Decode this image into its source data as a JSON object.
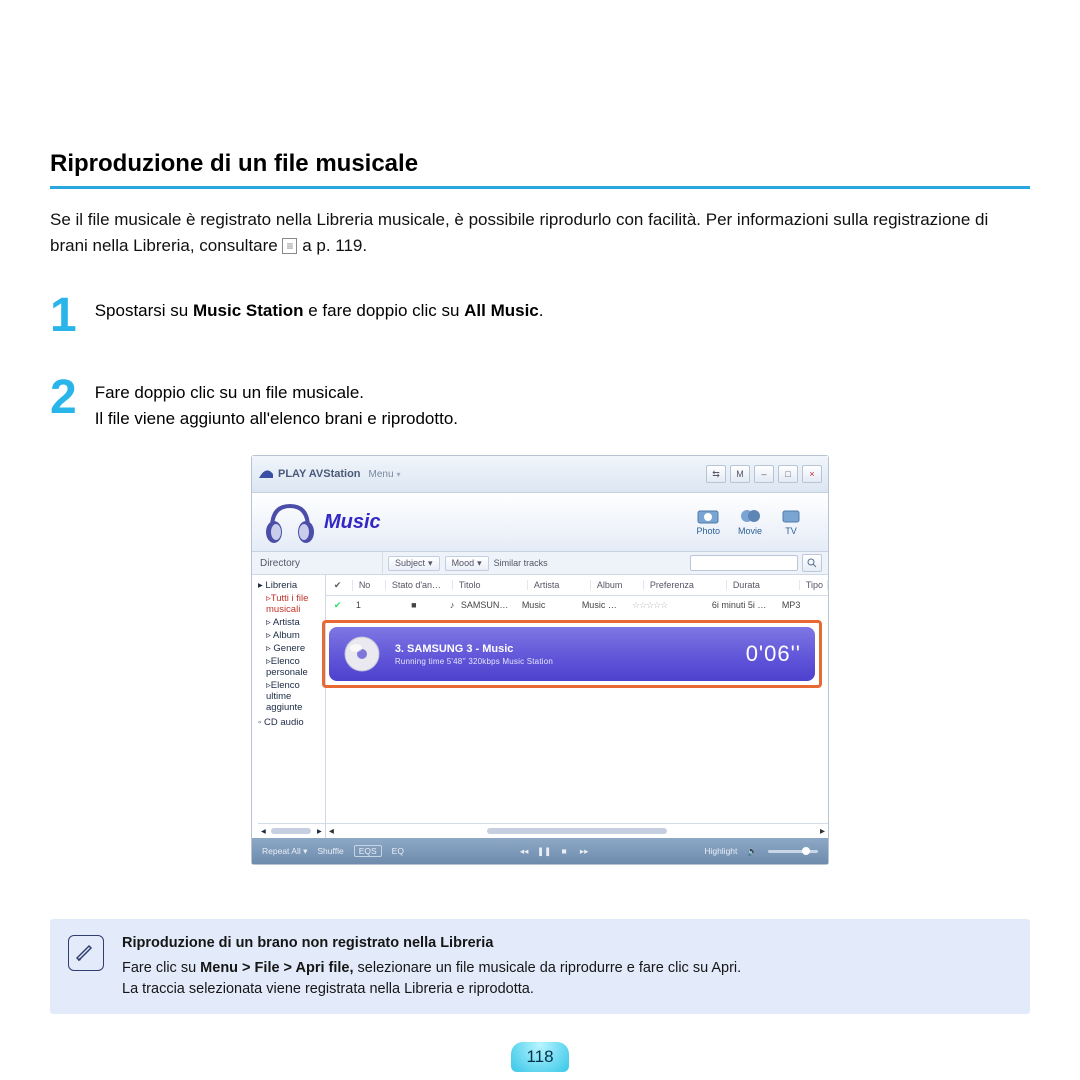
{
  "page_number": "118",
  "heading": "Riproduzione di un file musicale",
  "intro_a": "Se il file musicale è registrato nella Libreria musicale, è possibile riprodurlo con facilità. Per informazioni sulla registrazione di brani nella Libreria, consultare ",
  "intro_ref": "📄",
  "intro_b": " a p. 119.",
  "steps": {
    "s1_num": "1",
    "s1_a": "Spostarsi su ",
    "s1_b": "Music Station",
    "s1_c": " e fare doppio clic su ",
    "s1_d": "All Music",
    "s1_e": ".",
    "s2_num": "2",
    "s2_l1": "Fare doppio clic su un file musicale.",
    "s2_l2": "Il file viene aggiunto all'elenco brani e riprodotto."
  },
  "app": {
    "name": "PLAY AVStation",
    "menu": "Menu",
    "winbtns": {
      "b1": "⇆",
      "b2": "M",
      "b3": "–",
      "b4": "□",
      "close": "×"
    },
    "tab_label": "Music",
    "modes": {
      "photo": "Photo",
      "movie": "Movie",
      "tv": "TV"
    },
    "dir_head": "Directory",
    "filter_subject": "Subject",
    "filter_mood": "Mood",
    "filter_similar": "Similar tracks",
    "sidebar": {
      "root": "Libreria",
      "n1": "Tutti i file musicali",
      "n2": "Artista",
      "n3": "Album",
      "n4": "Genere",
      "n5": "Elenco personale",
      "n6": "Elenco ultime aggiunte",
      "n7": "CD audio"
    },
    "cols": {
      "chk": "✔",
      "no": "No",
      "state": "Stato d'an…",
      "title": "Titolo",
      "artist": "Artista",
      "album": "Album",
      "pref": "Preferenza",
      "dur": "Durata",
      "type": "Tipo"
    },
    "row1": {
      "chk": "✔",
      "no": "1",
      "state": "■",
      "title": " SAMSUN…",
      "artist": "Music",
      "album": "Music …",
      "pref": "☆☆☆☆☆",
      "dur": "6i minuti  5i …",
      "type": "MP3"
    },
    "np": {
      "title": "3.  SAMSUNG 3 - Music",
      "sub": "Running time 5'48''    320kbps    Music Station",
      "time": "0'06''"
    },
    "bottom": {
      "repeat": "Repeat All",
      "shuffle": "Shuffle",
      "eqs": "EQS",
      "eq": "EQ",
      "hl": "Highlight"
    }
  },
  "note": {
    "title": "Riproduzione di un brano non registrato nella Libreria",
    "l1a": "Fare clic su ",
    "l1b": "Menu > File > Apri file,",
    "l1c": " selezionare un file musicale da riprodurre e fare clic su Apri.",
    "l2": "La traccia selezionata viene registrata nella Libreria e riprodotta."
  }
}
